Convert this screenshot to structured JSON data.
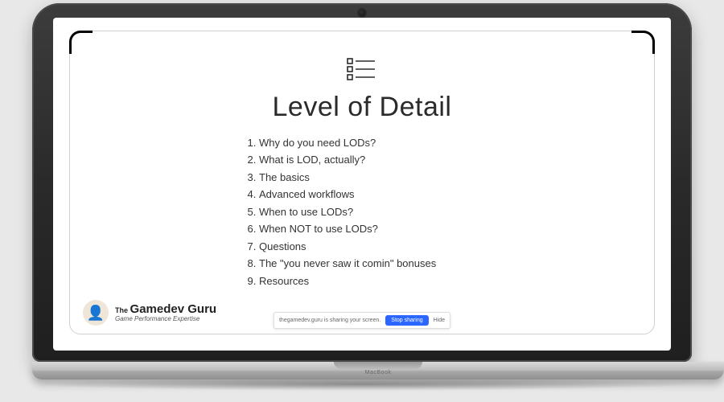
{
  "slide": {
    "title": "Level of Detail",
    "items": [
      "Why do you need LODs?",
      "What is LOD, actually?",
      "The basics",
      "Advanced workflows",
      "When to use LODs?",
      "When NOT to use LODs?",
      "Questions",
      "The \"you never saw it comin\" bonuses",
      "Resources"
    ]
  },
  "brand": {
    "prefix": "The",
    "name": "Gamedev Guru",
    "tagline": "Game Performance Expertise"
  },
  "sharebar": {
    "message": "thegamedev.guru is sharing your screen.",
    "stop": "Stop sharing",
    "hide": "Hide"
  },
  "device": {
    "label": "MacBook"
  }
}
